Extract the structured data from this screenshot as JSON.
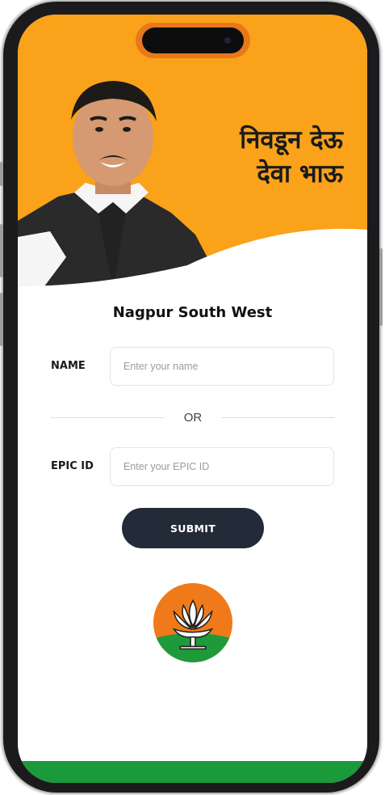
{
  "header": {
    "slogan_line1": "निवडून देऊ",
    "slogan_line2": "देवा भाऊ"
  },
  "form": {
    "title": "Nagpur South West",
    "name_label": "NAME",
    "name_placeholder": "Enter your name",
    "name_value": "",
    "or_text": "OR",
    "epic_label": "EPIC ID",
    "epic_placeholder": "Enter your EPIC ID",
    "epic_value": "",
    "submit_label": "SUBMIT"
  },
  "icons": {
    "logo": "lotus-logo-icon",
    "camera": "front-camera-icon"
  },
  "colors": {
    "hero_orange": "#f9a21a",
    "submit_dark": "#232a38",
    "logo_saffron": "#f07a1a",
    "logo_green": "#1f9a3a",
    "footer_green": "#1a9a3a"
  }
}
